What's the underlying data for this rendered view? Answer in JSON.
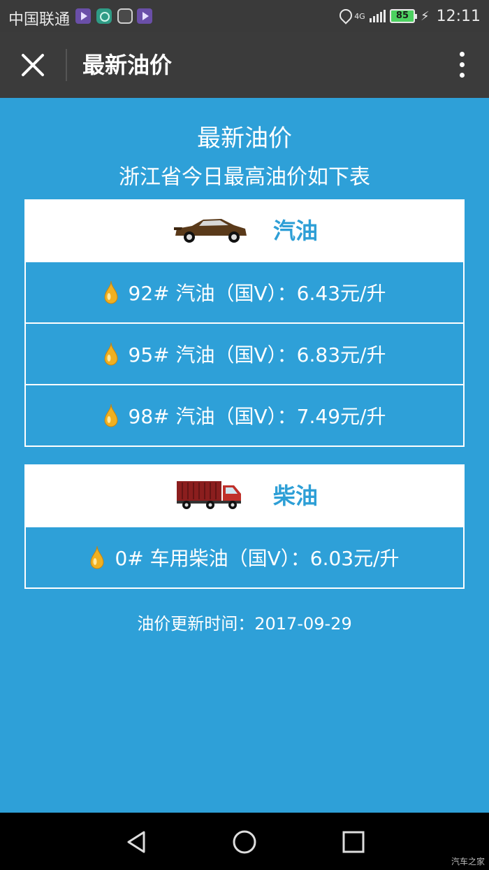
{
  "status_bar": {
    "carrier": "中国联通",
    "network_label": "4G",
    "battery": "85",
    "time": "12:11",
    "icons": [
      "play-app-icon",
      "green-app-icon",
      "hand-app-icon",
      "play-app-icon",
      "location-icon",
      "signal-icon",
      "battery-icon",
      "charging-icon"
    ]
  },
  "app_bar": {
    "title": "最新油价",
    "icons": [
      "close-icon",
      "more-icon"
    ]
  },
  "header": {
    "title": "最新油价",
    "subtitle": "浙江省今日最高油价如下表"
  },
  "gasoline": {
    "category": "汽油",
    "icon": "car-icon",
    "items": [
      {
        "label": "92# 汽油（国V）：6.43元/升"
      },
      {
        "label": "95# 汽油（国V）：6.83元/升"
      },
      {
        "label": "98# 汽油（国V）：7.49元/升"
      }
    ]
  },
  "diesel": {
    "category": "柴油",
    "icon": "truck-icon",
    "items": [
      {
        "label": "0# 车用柴油（国V）：6.03元/升"
      }
    ]
  },
  "footer": {
    "update_time": "油价更新时间：2017-09-29"
  },
  "nav_bar": {
    "icons": [
      "back-icon",
      "home-icon",
      "recent-apps-icon"
    ],
    "watermark": "汽车之家"
  },
  "colors": {
    "background": "#2ea0d8",
    "category_text": "#2e9fd6",
    "drop": "#f0b020"
  }
}
